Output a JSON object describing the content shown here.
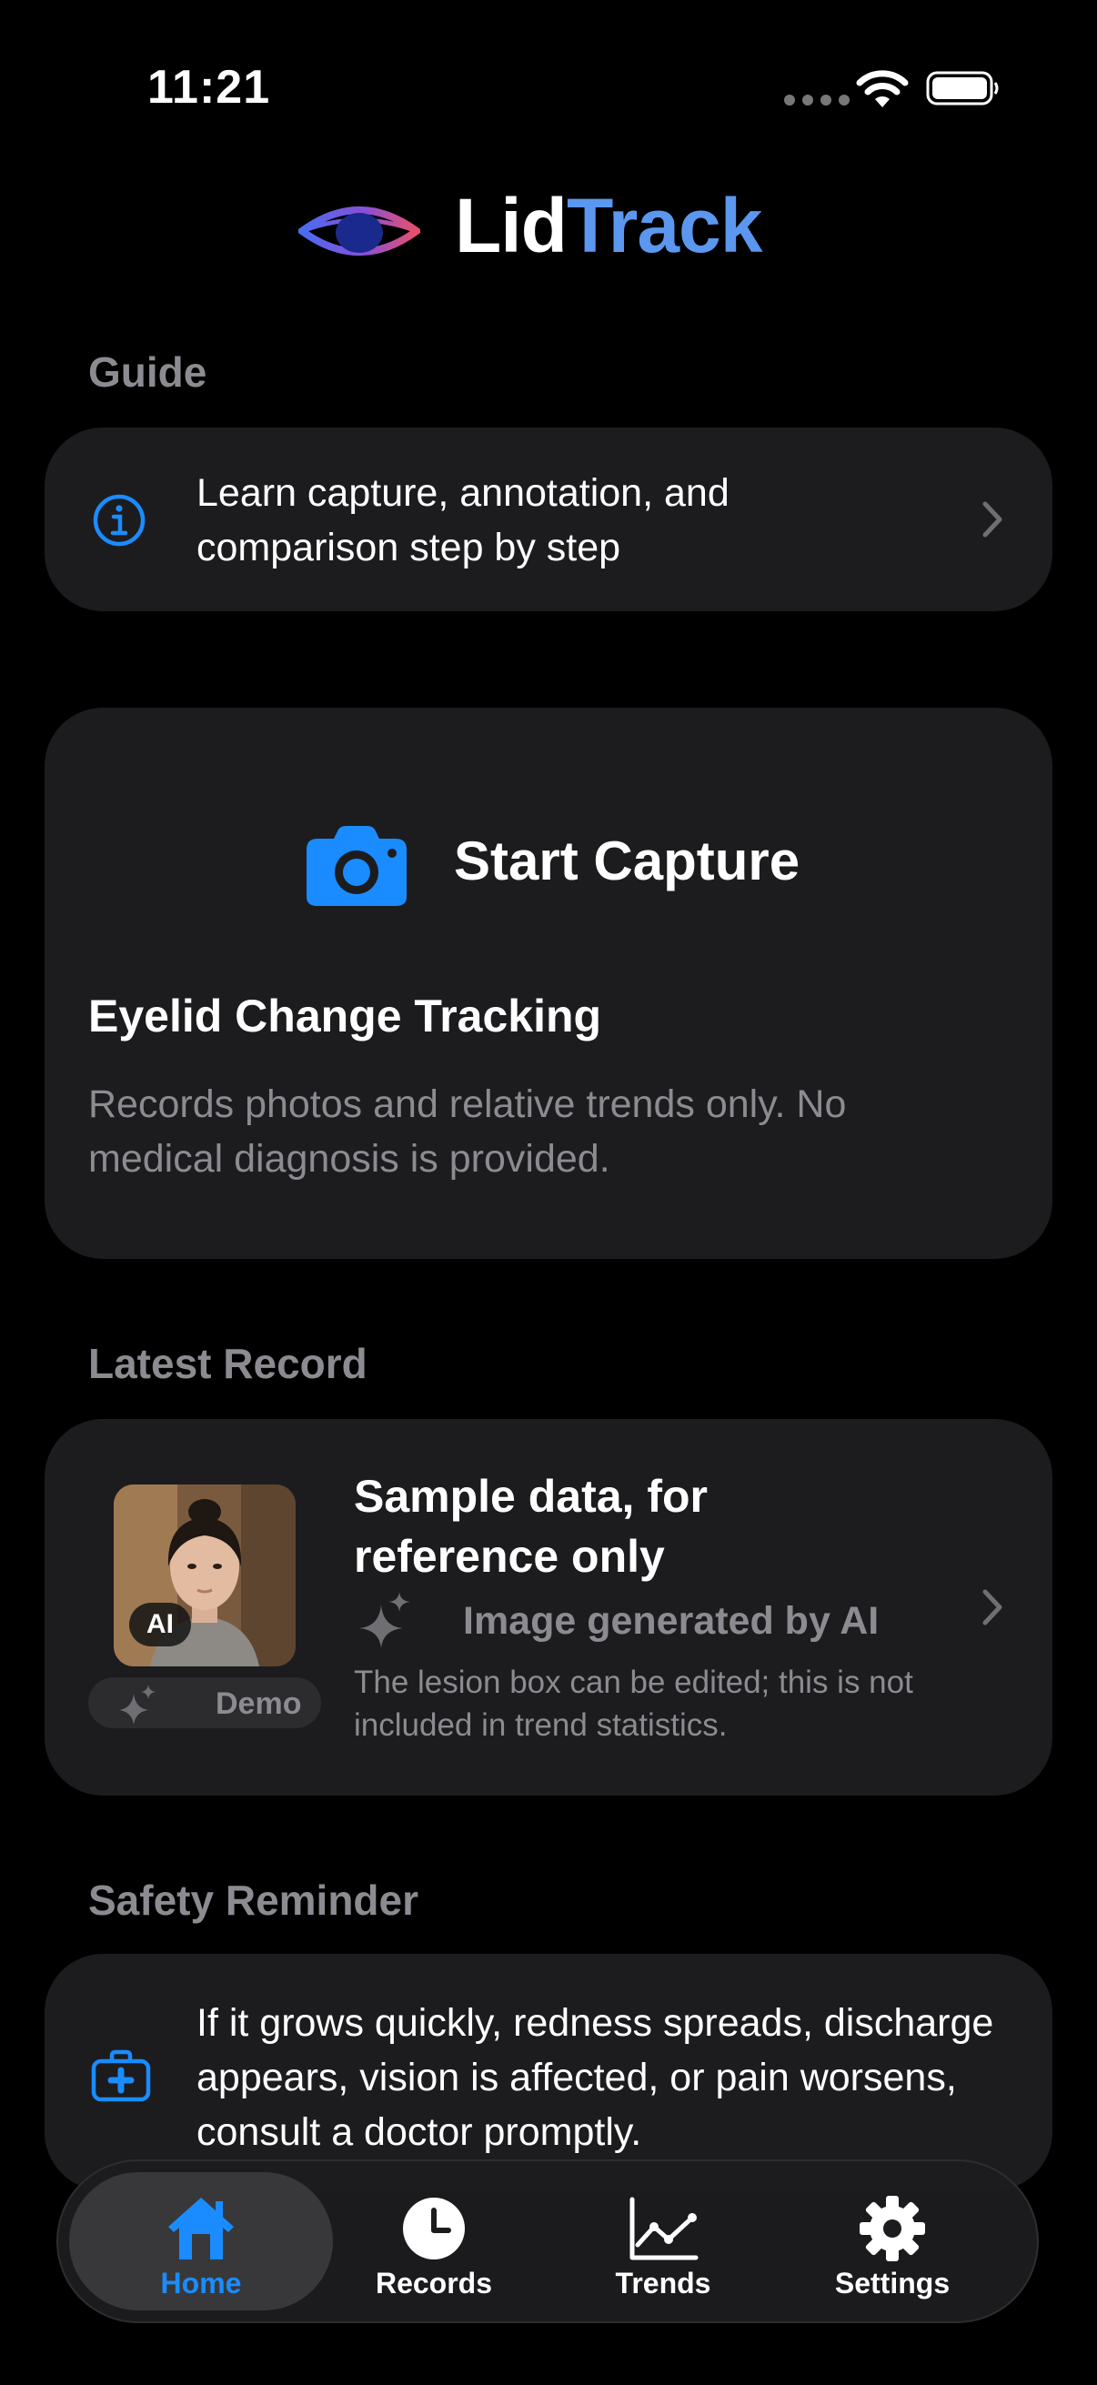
{
  "status_bar": {
    "time": "11:21"
  },
  "header": {
    "title_part1": "Lid",
    "title_part2": "Track"
  },
  "guide": {
    "section_title": "Guide",
    "text": "Learn capture, annotation, and comparison step by step"
  },
  "capture": {
    "button_label": "Start Capture",
    "heading": "Eyelid Change Tracking",
    "description": "Records photos and relative trends only. No medical diagnosis is provided."
  },
  "latest_record": {
    "section_title": "Latest Record",
    "ai_badge": "AI",
    "demo_label": "Demo",
    "title": "Sample data, for reference only",
    "tag": "Image generated by AI",
    "note": "The lesion box can be edited; this is not included in trend statistics."
  },
  "safety": {
    "section_title": "Safety Reminder",
    "text": "If it grows quickly, redness spreads, discharge appears, vision is affected, or pain worsens, consult a doctor promptly."
  },
  "tabbar": {
    "tabs": [
      {
        "label": "Home",
        "icon": "house-icon",
        "active": true
      },
      {
        "label": "Records",
        "icon": "clock-icon",
        "active": false
      },
      {
        "label": "Trends",
        "icon": "chart-icon",
        "active": false
      },
      {
        "label": "Settings",
        "icon": "gear-icon",
        "active": false
      }
    ]
  },
  "colors": {
    "accent": "#1a8cff",
    "background": "#000000",
    "card": "#1c1c1e",
    "secondary_text": "#8b8b91",
    "title_blue": "#5c97ef"
  }
}
